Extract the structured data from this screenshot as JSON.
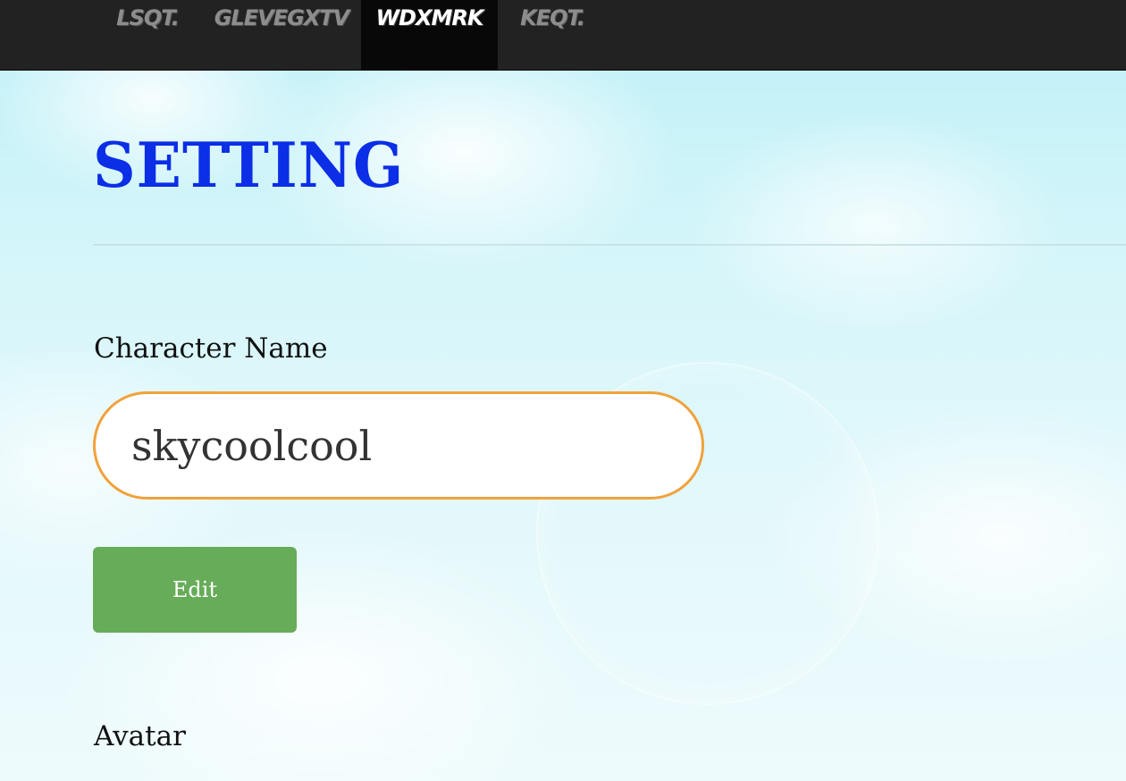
{
  "navbar": {
    "items": [
      {
        "label": "LSQT."
      },
      {
        "label": "GLEVEGXTV"
      },
      {
        "label": "WDXMRK"
      },
      {
        "label": "KEQT."
      }
    ],
    "active_index": 2
  },
  "page": {
    "title": "SETTING"
  },
  "character_name": {
    "label": "Character Name",
    "value": "skycoolcool"
  },
  "edit_button": {
    "label": "Edit"
  },
  "avatar": {
    "label": "Avatar"
  },
  "colors": {
    "navbar_bg": "#222222",
    "nav_active_bg": "#080808",
    "title": "#0b2ee6",
    "input_border": "#f0a23b",
    "edit_button_bg": "#67ac59"
  }
}
